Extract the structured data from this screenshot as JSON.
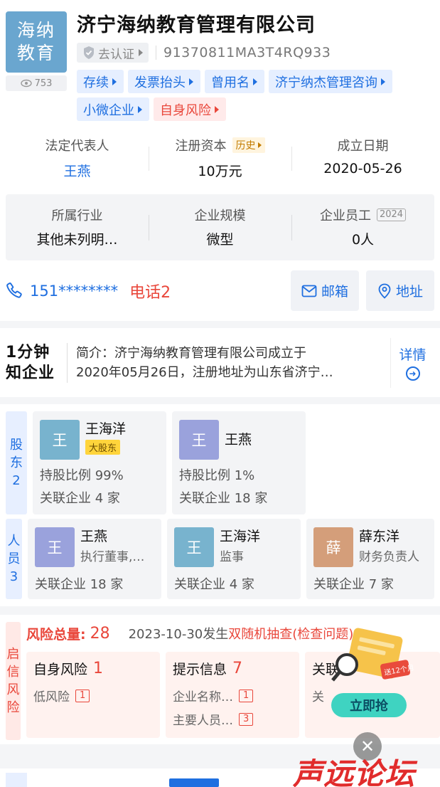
{
  "header": {
    "logo_line1": "海纳",
    "logo_line2": "教育",
    "views": "753",
    "company_name": "济宁海纳教育管理有限公司",
    "cert_label": "去认证",
    "credit_code": "91370811MA3T4RQ933",
    "tags": [
      "存续",
      "发票抬头",
      "曾用名",
      "济宁纳杰管理咨询",
      "小微企业",
      "自身风险"
    ]
  },
  "basic": {
    "legal_rep_label": "法定代表人",
    "legal_rep": "王燕",
    "capital_label": "注册资本",
    "history_label": "历史",
    "capital": "10万元",
    "founded_label": "成立日期",
    "founded": "2020-05-26",
    "industry_label": "所属行业",
    "industry": "其他未列明…",
    "scale_label": "企业规模",
    "scale": "微型",
    "staff_label": "企业员工",
    "staff_year": "2024",
    "staff": "0人"
  },
  "contact": {
    "phone": "151********",
    "phone_count": "电话2",
    "email_label": "邮箱",
    "address_label": "地址"
  },
  "intro": {
    "logo_line1": "1分钟",
    "logo_line2": "知企业",
    "line1": "简介：济宁海纳教育管理有限公司成立于",
    "line2": "2020年05月26日，注册地址为山东省济宁…",
    "detail_label": "详情"
  },
  "shareholders": {
    "tab": [
      "股",
      "东",
      "2"
    ],
    "items": [
      {
        "avatar": "王",
        "name": "王海洋",
        "badge": "大股东",
        "ratio": "持股比例 99%",
        "related": "关联企业 4 家"
      },
      {
        "avatar": "王",
        "name": "王燕",
        "ratio": "持股比例 1%",
        "related": "关联企业 18 家"
      }
    ]
  },
  "staff": {
    "tab": [
      "人",
      "员",
      "3"
    ],
    "items": [
      {
        "avatar": "王",
        "name": "王燕",
        "role": "执行董事,…",
        "related": "关联企业 18 家"
      },
      {
        "avatar": "王",
        "name": "王海洋",
        "role": "监事",
        "related": "关联企业 4 家"
      },
      {
        "avatar": "薛",
        "name": "薛东洋",
        "role": "财务负责人",
        "related": "关联企业 7 家"
      }
    ]
  },
  "risk": {
    "tab": [
      "启",
      "信",
      "风",
      "险"
    ],
    "total_label": "风险总量:",
    "total": "28",
    "event_prefix": "2023-10-30发生",
    "event_highlight": "双随机抽查",
    "event_suffix": "(检查问题)",
    "cards": [
      {
        "title": "自身风险",
        "num": "1",
        "lines": [
          {
            "text": "低风险",
            "count": "1"
          }
        ]
      },
      {
        "title": "提示信息",
        "num": "7",
        "lines": [
          {
            "text": "企业名称…",
            "count": "1"
          },
          {
            "text": "主要人员…",
            "count": "3"
          }
        ]
      },
      {
        "title": "关联",
        "num": "",
        "lines": [
          {
            "text": "关",
            "count": ""
          }
        ]
      }
    ]
  },
  "promo": {
    "button": "立即抢",
    "sticker": "送12个月"
  },
  "watermark": "声远论坛"
}
